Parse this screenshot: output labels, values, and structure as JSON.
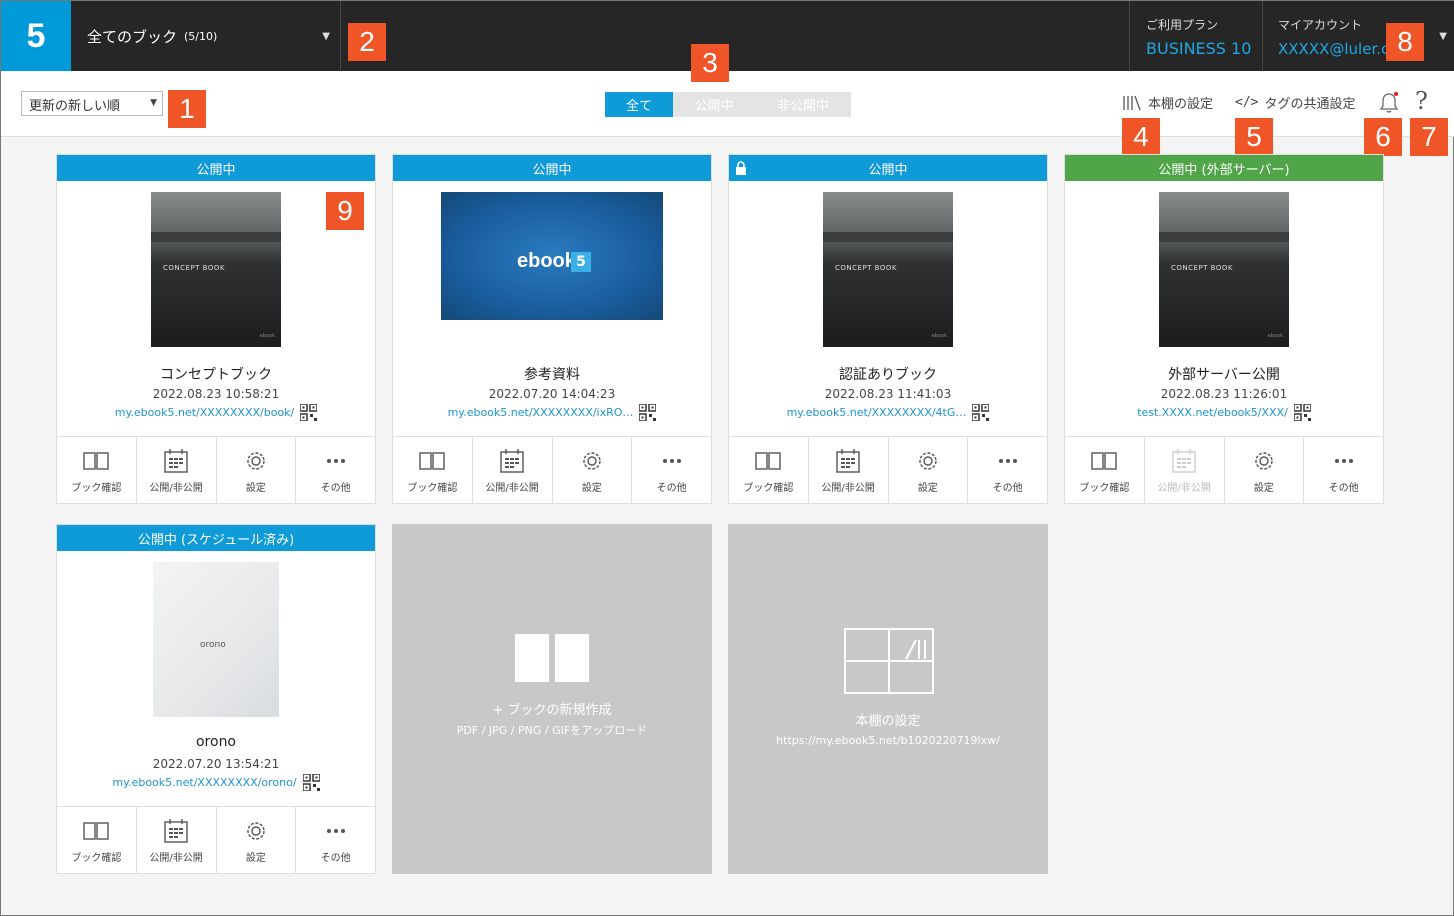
{
  "header": {
    "logo": "5",
    "book_select_label": "全てのブック",
    "book_select_count": "(5/10)",
    "plan_label": "ご利用プラン",
    "plan_value": "BUSINESS 10",
    "account_label": "マイアカウント",
    "account_value": "XXXXX@luler.c"
  },
  "toolbar": {
    "sort_value": "更新の新しい順",
    "filter_tabs": [
      "全て",
      "公開中",
      "非公開中"
    ],
    "shelf_settings": "本棚の設定",
    "tag_settings": "タグの共通設定",
    "help": "?"
  },
  "markers": [
    "1",
    "2",
    "3",
    "4",
    "5",
    "6",
    "7",
    "8",
    "9"
  ],
  "cover_text": {
    "concept": "CONCEPT BOOK",
    "ebook": "ebook",
    "ebook5": "5",
    "orono": "orono"
  },
  "actions": {
    "preview": "ブック確認",
    "publish": "公開/非公開",
    "settings": "設定",
    "more": "その他"
  },
  "books": [
    {
      "status": "公開中",
      "name": "コンセプトブック",
      "date": "2022.08.23 10:58:21",
      "url": "my.ebook5.net/XXXXXXXX/book/"
    },
    {
      "status": "公開中",
      "name": "参考資料",
      "date": "2022.07.20 14:04:23",
      "url": "my.ebook5.net/XXXXXXXX/ixRO…"
    },
    {
      "status": "公開中",
      "name": "認証ありブック",
      "date": "2022.08.23 11:41:03",
      "url": "my.ebook5.net/XXXXXXXX/4tG…"
    },
    {
      "status": "公開中 (外部サーバー)",
      "name": "外部サーバー公開",
      "date": "2022.08.23 11:26:01",
      "url": "test.XXXX.net/ebook5/XXX/"
    },
    {
      "status": "公開中 (スケジュール済み)",
      "name": "orono",
      "date": "2022.07.20 13:54:21",
      "url": "my.ebook5.net/XXXXXXXX/orono/"
    }
  ],
  "new_book_tile": {
    "title": "+ ブックの新規作成",
    "subtitle": "PDF / JPG / PNG / GIFをアップロード"
  },
  "shelf_tile": {
    "title": "本棚の設定",
    "url": "https://my.ebook5.net/b1020220719lxw/"
  },
  "colors": {
    "accent": "#0f9bd7",
    "external": "#4fa548",
    "marker": "#f05528",
    "header_bg": "#262626"
  }
}
